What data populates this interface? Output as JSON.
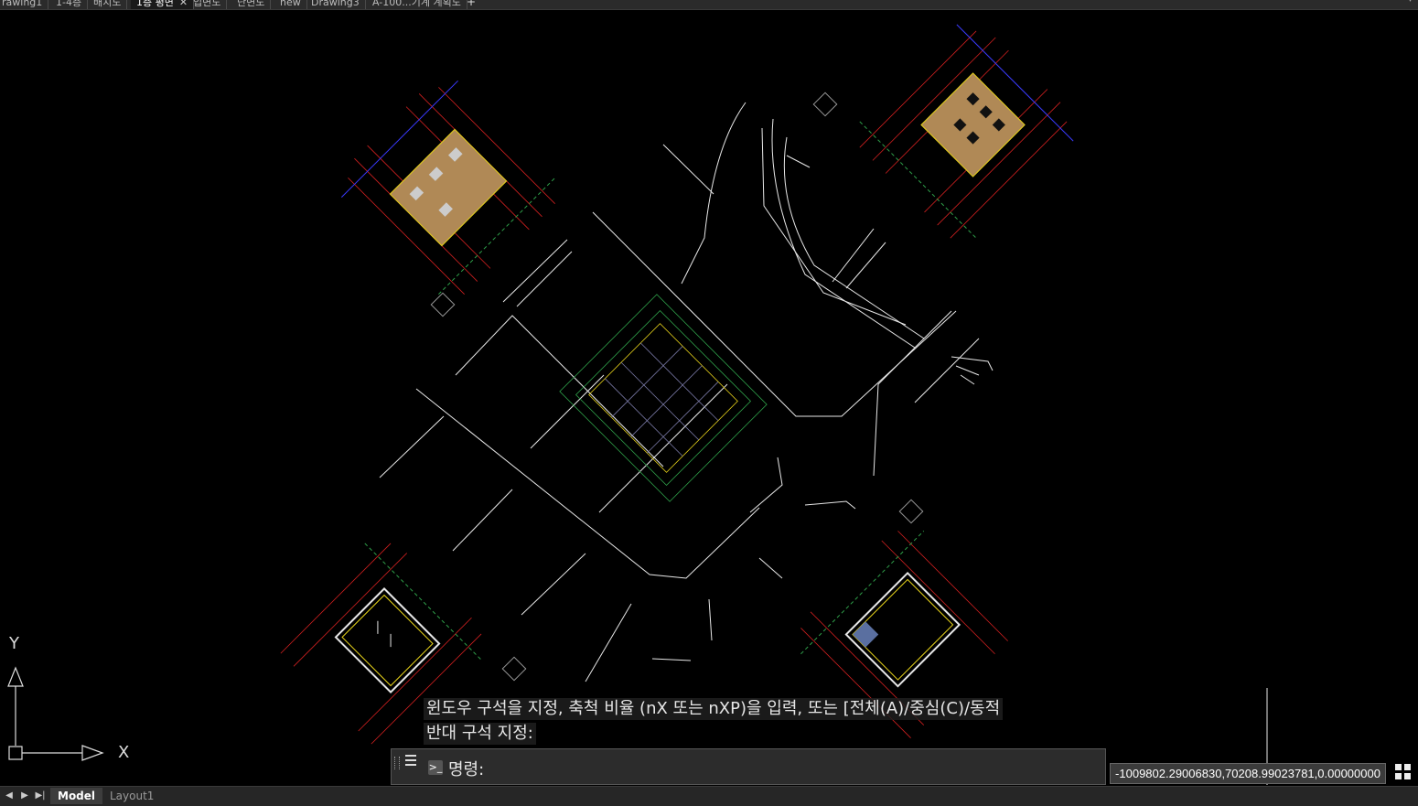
{
  "file_tabs": [
    {
      "label": "rawing1"
    },
    {
      "label": "1-4층"
    },
    {
      "label": "배치도"
    },
    {
      "label": "1층 평면",
      "active": true
    },
    {
      "label": "입면도"
    },
    {
      "label": "단면도"
    },
    {
      "label": "new"
    },
    {
      "label": "Drawing3"
    },
    {
      "label": "A-100...기계 계획도"
    }
  ],
  "ucs": {
    "x_label": "X",
    "y_label": "Y"
  },
  "command": {
    "history": [
      "윈도우 구석을 지정, 축척 비율 (nX 또는 nXP)을 입력, 또는 [전체(A)/중심(C)/동적",
      "반대 구석 지정:"
    ],
    "prompt": "명령:"
  },
  "coordinates": "-1009802.29006830,70208.99023781,0.00000000",
  "layout_tabs": [
    {
      "label": "Model",
      "active": true
    },
    {
      "label": "Layout1",
      "active": false
    }
  ],
  "colors": {
    "background": "#000000",
    "building_fill": "#b08956",
    "line_white": "#e8e8e8",
    "line_red": "#d42020",
    "line_yellow": "#e6d21a",
    "line_green": "#2fa04a",
    "line_blue": "#3a3aff",
    "line_magenta": "#d12ad1"
  }
}
